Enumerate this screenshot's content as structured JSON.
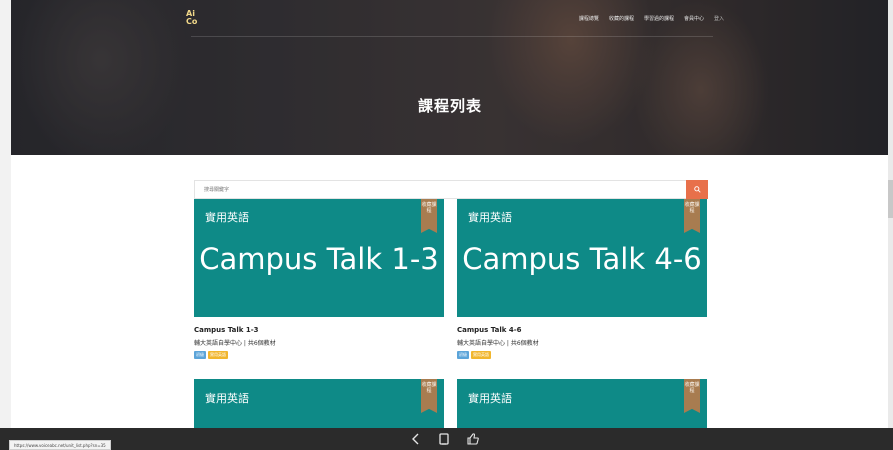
{
  "header": {
    "logo_top": "Ai",
    "logo_bottom": "Co",
    "nav": [
      "課程總覽",
      "收藏的課程",
      "學習過的課程",
      "會員中心",
      "登入"
    ]
  },
  "hero": {
    "title": "課程列表"
  },
  "search": {
    "placeholder": "搜尋關鍵字"
  },
  "courses": [
    {
      "category": "實用英語",
      "big_title": "Campus Talk 1-3",
      "ribbon": "收藏課程",
      "title": "Campus Talk 1-3",
      "subtitle": "輔大英語自學中心 | 共6個教材",
      "tags": [
        "初級",
        "實用英語"
      ]
    },
    {
      "category": "實用英語",
      "big_title": "Campus Talk 4-6",
      "ribbon": "收藏課程",
      "title": "Campus Talk 4-6",
      "subtitle": "輔大英語自學中心 | 共6個教材",
      "tags": [
        "初級",
        "實用英語"
      ]
    },
    {
      "category": "實用英語",
      "ribbon": "收藏課程"
    },
    {
      "category": "實用英語",
      "ribbon": "收藏課程"
    }
  ],
  "status_url": "https://www.voiceabc.net/unit_list.php?sn=35",
  "colors": {
    "card_teal": "#0e8a87",
    "ribbon": "#a87c50",
    "search_button": "#e8704a"
  },
  "icons": {
    "search": "search-icon",
    "back": "back-arrow-icon",
    "tabs": "tabs-icon",
    "like": "thumbs-up-icon"
  }
}
